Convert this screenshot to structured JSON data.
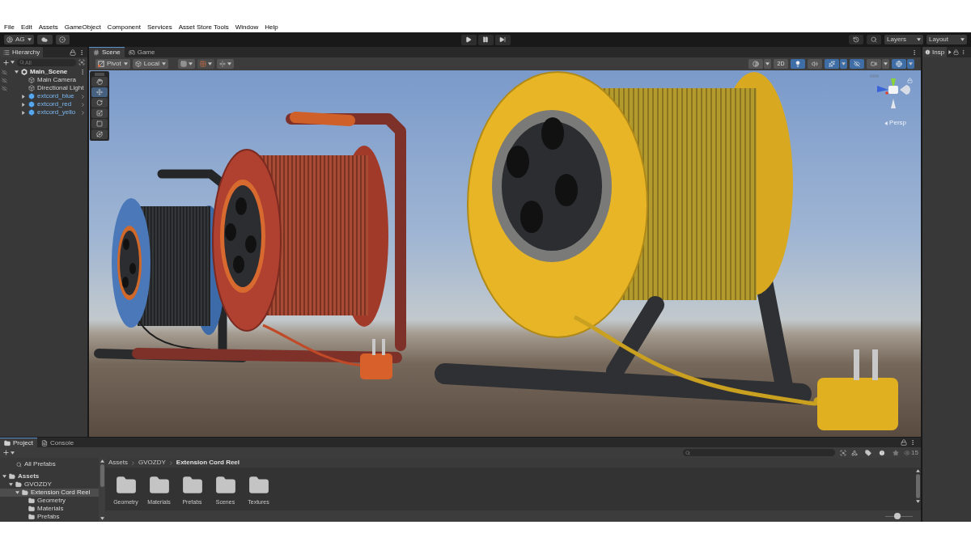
{
  "menu_bar": [
    "File",
    "Edit",
    "Assets",
    "GameObject",
    "Component",
    "Services",
    "Asset Store Tools",
    "Window",
    "Help"
  ],
  "toolbar": {
    "account": "AG",
    "layers": "Layers",
    "layout": "Layout"
  },
  "hierarchy": {
    "title": "Hierarchy",
    "search_placeholder": "All",
    "tree": [
      {
        "name": "Main_Scene",
        "kind": "scene",
        "expanded": true,
        "scene_visibility": true,
        "children": [
          {
            "name": "Main Camera",
            "kind": "gameobject",
            "scene_visibility": true
          },
          {
            "name": "Directional Light",
            "kind": "gameobject",
            "scene_visibility": true
          },
          {
            "name": "extcord_blue",
            "kind": "prefab",
            "expanded": false,
            "scene_visibility": false
          },
          {
            "name": "extcord_red",
            "kind": "prefab",
            "expanded": false,
            "scene_visibility": false
          },
          {
            "name": "extcord_yello",
            "kind": "prefab",
            "expanded": false,
            "scene_visibility": false
          }
        ]
      }
    ]
  },
  "scene_view": {
    "tabs": [
      {
        "label": "Scene",
        "kind": "scene",
        "selected": true
      },
      {
        "label": "Game",
        "kind": "game",
        "selected": false
      }
    ],
    "pivot": "Pivot",
    "space": "Local",
    "view_toggles": [
      {
        "kind": "shading",
        "on": false
      },
      {
        "kind": "flat",
        "label": "2D",
        "on": false
      },
      {
        "kind": "lighting",
        "on": true
      },
      {
        "kind": "audio",
        "on": false
      },
      {
        "kind": "effects",
        "on": true
      },
      {
        "kind": "visibility",
        "on": true
      },
      {
        "kind": "camera",
        "on": false
      },
      {
        "kind": "gizmos",
        "on": true
      }
    ],
    "tools": [
      {
        "kind": "view",
        "selected": false
      },
      {
        "kind": "move",
        "selected": true
      },
      {
        "kind": "rotate",
        "selected": false
      },
      {
        "kind": "scale",
        "selected": false
      },
      {
        "kind": "rect",
        "selected": false
      },
      {
        "kind": "transform",
        "selected": false
      }
    ],
    "projection": "Persp"
  },
  "inspector": {
    "title": "Insp"
  },
  "project": {
    "tabs": [
      {
        "label": "Project",
        "kind": "project",
        "selected": true
      },
      {
        "label": "Console",
        "kind": "console",
        "selected": false
      }
    ],
    "favorites": [
      "All Prefabs"
    ],
    "tree": [
      {
        "name": "Assets",
        "expanded": true,
        "selected": false,
        "children": [
          {
            "name": "GVOZDY",
            "expanded": true,
            "selected": false,
            "children": [
              {
                "name": "Extension Cord Reel",
                "expanded": true,
                "selected": true,
                "children": [
                  {
                    "name": "Geometry",
                    "selected": false
                  },
                  {
                    "name": "Materials",
                    "selected": false
                  },
                  {
                    "name": "Prefabs",
                    "selected": false
                  }
                ]
              }
            ]
          }
        ]
      }
    ],
    "breadcrumb": [
      "Assets",
      "GVOZDY",
      "Extension Cord Reel"
    ],
    "folders": [
      "Geometry",
      "Materials",
      "Prefabs",
      "Scenes",
      "Textures"
    ],
    "hidden_count": "15",
    "zoom": {
      "level": 0.45
    }
  }
}
